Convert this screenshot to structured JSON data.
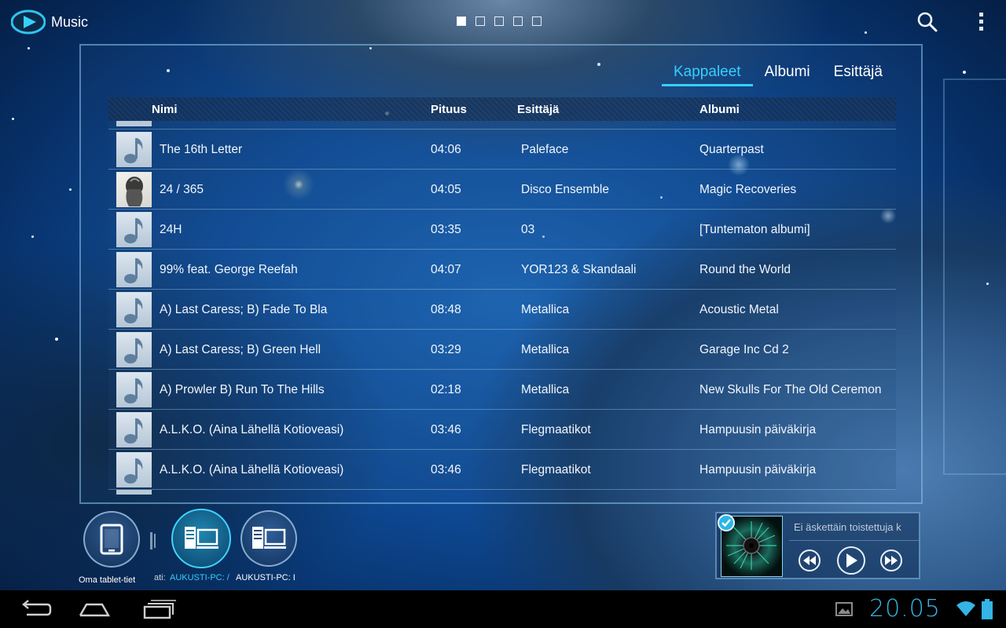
{
  "app": {
    "title": "Music",
    "icon": "play-logo-icon"
  },
  "header": {
    "page_indicator": {
      "count": 5,
      "active_index": 0
    },
    "search_icon": "search-icon",
    "overflow_icon": "overflow-menu-icon"
  },
  "tabs": [
    {
      "label": "Kappaleet",
      "active": true
    },
    {
      "label": "Albumi",
      "active": false
    },
    {
      "label": "Esittäjä",
      "active": false
    }
  ],
  "table": {
    "columns": {
      "name": "Nimi",
      "length": "Pituus",
      "artist": "Esittäjä",
      "album": "Albumi"
    },
    "rows": [
      {
        "name": "The 16th Letter",
        "length": "04:06",
        "artist": "Paleface",
        "album": "Quarterpast",
        "art": "note"
      },
      {
        "name": "24 / 365",
        "length": "04:05",
        "artist": "Disco Ensemble",
        "album": "Magic Recoveries",
        "art": "cover"
      },
      {
        "name": "24H",
        "length": "03:35",
        "artist": "03",
        "album": "[Tuntematon albumi]",
        "art": "note"
      },
      {
        "name": "99% feat. George Reefah",
        "length": "04:07",
        "artist": "YOR123 & Skandaali",
        "album": "Round the World",
        "art": "note"
      },
      {
        "name": "A) Last Caress; B) Fade To Bla",
        "length": "08:48",
        "artist": "Metallica",
        "album": "Acoustic Metal",
        "art": "note"
      },
      {
        "name": "A) Last Caress; B) Green Hell",
        "length": "03:29",
        "artist": "Metallica",
        "album": "Garage Inc Cd 2",
        "art": "note"
      },
      {
        "name": "A) Prowler B) Run To The Hills",
        "length": "02:18",
        "artist": "Metallica",
        "album": "New Skulls For The Old Ceremon",
        "art": "note"
      },
      {
        "name": "A.L.K.O. (Aina Lähellä Kotioveasi)",
        "length": "03:46",
        "artist": "Flegmaatikot",
        "album": "Hampuusin päiväkirja",
        "art": "note"
      },
      {
        "name": "A.L.K.O. (Aina Lähellä Kotioveasi)",
        "length": "03:46",
        "artist": "Flegmaatikot",
        "album": "Hampuusin päiväkirja",
        "art": "note"
      }
    ]
  },
  "devices": {
    "labels": [
      "Oma tablet-tiet",
      "ati:",
      "AUKUSTI-PC: /",
      "AUKUSTI-PC: I"
    ],
    "items": [
      {
        "icon": "tablet-icon",
        "active": false
      },
      {
        "icon": "pc-server-icon",
        "active": true
      },
      {
        "icon": "pc-server-icon",
        "active": false
      }
    ]
  },
  "now_playing": {
    "status": "Ei äskettäin toistettuja k",
    "checked": true,
    "controls": [
      "previous-icon",
      "play-icon",
      "next-icon"
    ]
  },
  "system_bar": {
    "clock": "20.05",
    "accent": "#34b5e5",
    "buttons": [
      "back-icon",
      "home-icon",
      "recent-apps-icon"
    ],
    "status_icons": [
      "gallery-icon",
      "wifi-icon",
      "battery-icon"
    ]
  },
  "colors": {
    "accent": "#34d0ff",
    "panel_border": "#8cc8f0"
  }
}
